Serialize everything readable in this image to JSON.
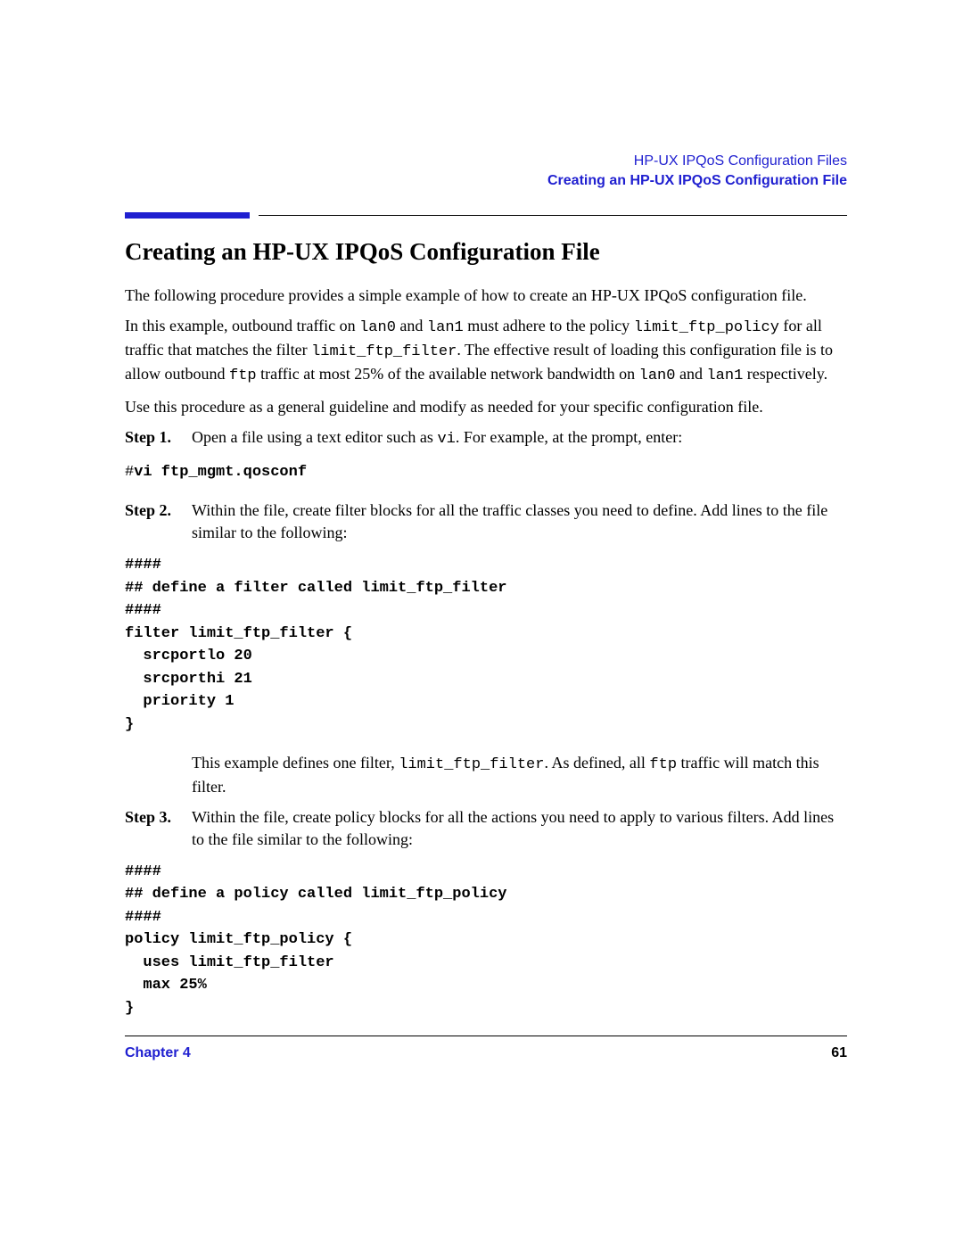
{
  "running_header": {
    "line1": "HP-UX IPQoS Configuration Files",
    "line2": "Creating an HP-UX IPQoS Configuration File"
  },
  "title": "Creating an HP-UX IPQoS Configuration File",
  "intro1": "The following procedure provides a simple example of how to create an HP-UX IPQoS configuration file.",
  "intro2": {
    "t1": "In this example,  outbound traffic on  ",
    "c1": "lan0",
    "t2": " and ",
    "c2": "lan1",
    "t3": " must adhere to the policy ",
    "c3": "limit_ftp_policy",
    "t4": " for all traffic that matches the filter ",
    "c4": "limit_ftp_filter",
    "t5": ". The effective result of loading this configuration file is to allow outbound ",
    "c5": "ftp",
    "t6": " traffic at most 25% of the available network bandwidth on ",
    "c6": "lan0",
    "t7": " and ",
    "c7": "lan1",
    "t8": " respectively."
  },
  "intro3": "Use this procedure as a general guideline and modify as needed for your specific configuration file.",
  "step1": {
    "label": "Step   1.",
    "t1": "Open a file using a text editor such as ",
    "c1": "vi",
    "t2": ". For example, at the prompt, enter:",
    "prompt": "#",
    "cmd": "vi ftp_mgmt.qosconf"
  },
  "step2": {
    "label": "Step   2.",
    "t1": "Within the file, create filter blocks for all the traffic classes you need to define. Add lines to the file similar to the following:",
    "code": "####\n## define a filter called limit_ftp_filter\n####\nfilter limit_ftp_filter {\n  srcportlo 20\n  srcporthi 21\n  priority 1\n}",
    "after_t1": "This example defines one filter,  ",
    "after_c1": "limit_ftp_filter",
    "after_t2": ". As defined, all ",
    "after_c2": "ftp",
    "after_t3": " traffic will match this filter."
  },
  "step3": {
    "label": "Step   3.",
    "t1": "Within the file, create policy blocks for all the actions you need to apply to various filters. Add lines to the file similar to the following:",
    "code": "####\n## define a policy called limit_ftp_policy\n####\npolicy limit_ftp_policy {\n  uses limit_ftp_filter\n  max 25%\n}"
  },
  "footer": {
    "chapter": "Chapter 4",
    "page": "61"
  }
}
